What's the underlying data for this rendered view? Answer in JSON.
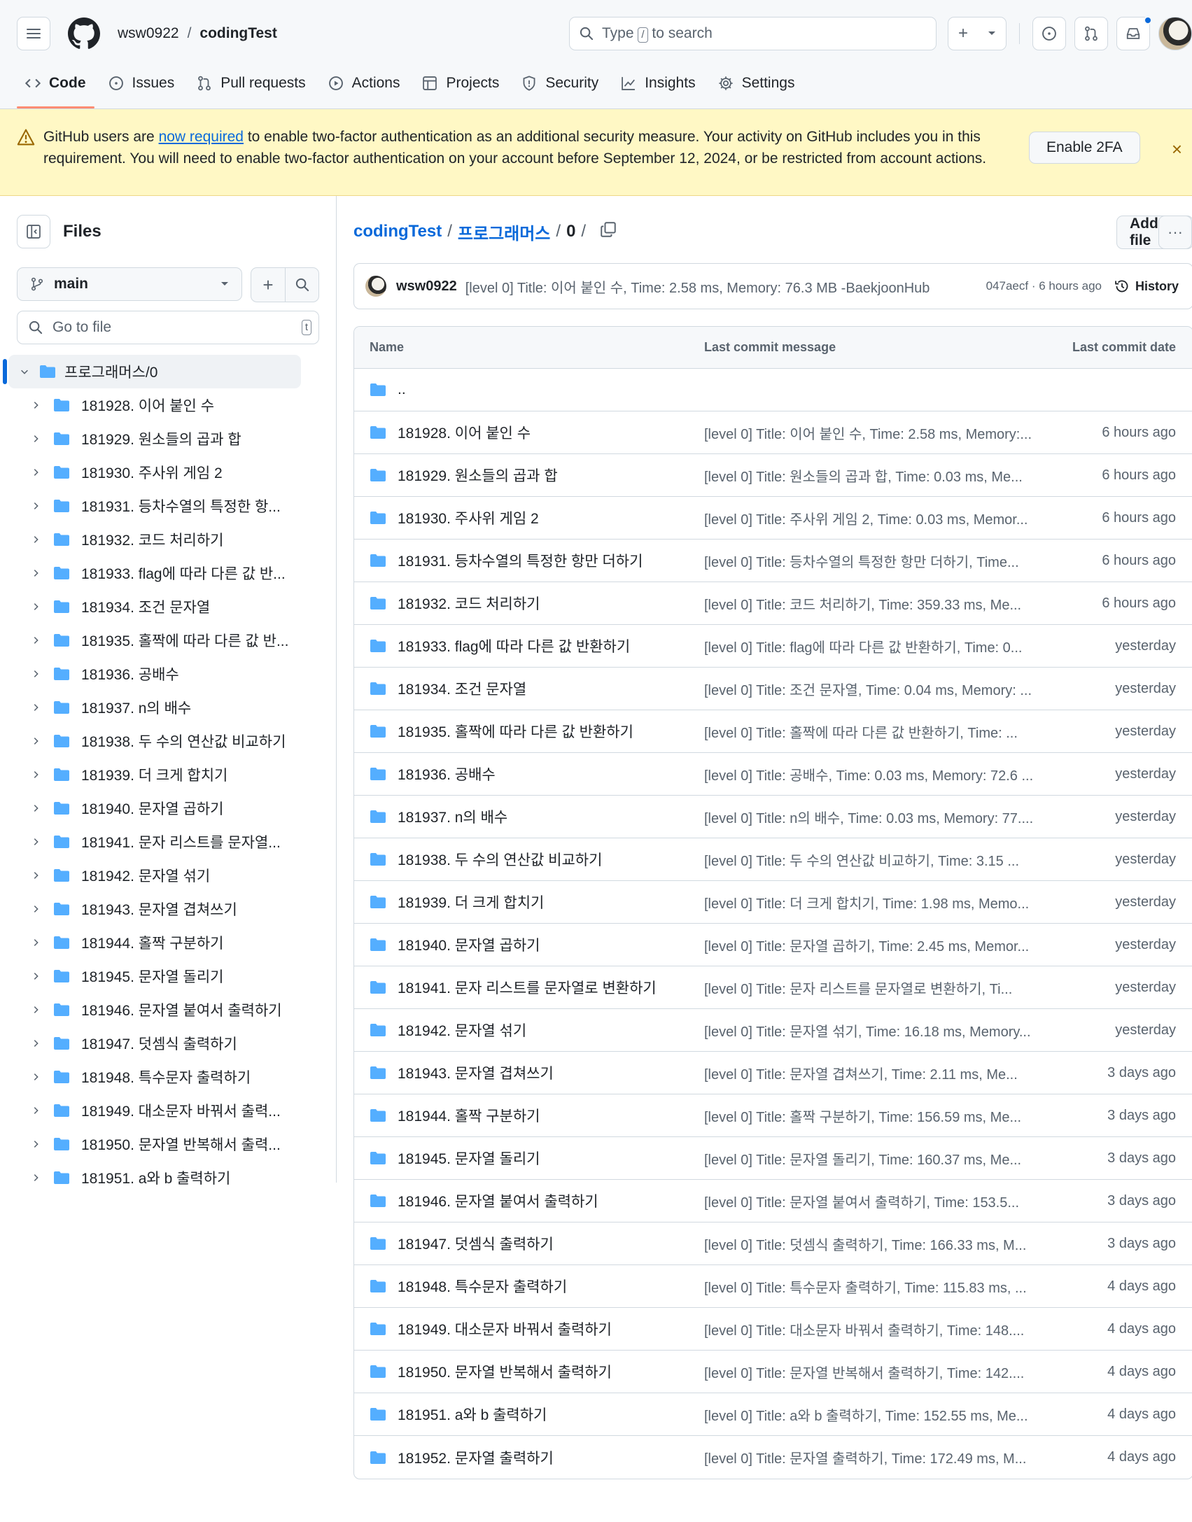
{
  "header": {
    "owner": "wsw0922",
    "separator": "/",
    "repo": "codingTest",
    "search_prefix": "Type",
    "search_key": "/",
    "search_suffix": "to search"
  },
  "nav": [
    {
      "label": "Code",
      "icon": "code-icon"
    },
    {
      "label": "Issues",
      "icon": "issue-opened-icon"
    },
    {
      "label": "Pull requests",
      "icon": "git-pull-request-icon"
    },
    {
      "label": "Actions",
      "icon": "play-icon"
    },
    {
      "label": "Projects",
      "icon": "table-icon"
    },
    {
      "label": "Security",
      "icon": "shield-icon"
    },
    {
      "label": "Insights",
      "icon": "graph-icon"
    },
    {
      "label": "Settings",
      "icon": "gear-icon"
    }
  ],
  "banner": {
    "text_before": "GitHub users are ",
    "link": "now required",
    "text_after": " to enable two-factor authentication as an additional security measure. Your activity on GitHub includes you in this requirement. You will need to enable two-factor authentication on your account before September 12, 2024, or be restricted from account actions.",
    "button": "Enable 2FA",
    "close": "×"
  },
  "sidebar": {
    "title": "Files",
    "branch": "main",
    "goto_placeholder": "Go to file",
    "goto_key": "t",
    "root": "프로그래머스/0",
    "items": [
      "181928. 이어 붙인 수",
      "181929. 원소들의 곱과 합",
      "181930. 주사위 게임 2",
      "181931. 등차수열의 특정한 항...",
      "181932. 코드 처리하기",
      "181933. flag에 따라 다른 값 반...",
      "181934. 조건 문자열",
      "181935. 홀짝에 따라 다른 값 반...",
      "181936. 공배수",
      "181937. n의 배수",
      "181938. 두 수의 연산값 비교하기",
      "181939. 더 크게 합치기",
      "181940. 문자열 곱하기",
      "181941. 문자 리스트를 문자열...",
      "181942. 문자열 섞기",
      "181943. 문자열 겹쳐쓰기",
      "181944. 홀짝 구분하기",
      "181945. 문자열 돌리기",
      "181946. 문자열 붙여서 출력하기",
      "181947. 덧셈식 출력하기",
      "181948. 특수문자 출력하기",
      "181949. 대소문자 바꿔서 출력...",
      "181950. 문자열 반복해서 출력...",
      "181951. a와 b 출력하기"
    ]
  },
  "breadcrumb": {
    "repo": "codingTest",
    "sep1": "/",
    "folder": "프로그래머스",
    "sep2": "/",
    "current": "0",
    "sep3": "/"
  },
  "actions": {
    "add_file": "Add file",
    "more": "···"
  },
  "latest_commit": {
    "author": "wsw0922",
    "message": "[level 0] Title: 이어 붙인 수, Time: 2.58 ms, Memory: 76.3 MB -BaekjoonHub",
    "meta": "047aecf · 6 hours ago",
    "history": "History"
  },
  "table": {
    "headers": {
      "name": "Name",
      "message": "Last commit message",
      "date": "Last commit date"
    },
    "parent": "..",
    "rows": [
      {
        "name": "181928. 이어 붙인 수",
        "message": "[level 0] Title: 이어 붙인 수, Time: 2.58 ms, Memory:...",
        "date": "6 hours ago"
      },
      {
        "name": "181929. 원소들의 곱과 합",
        "message": "[level 0] Title: 원소들의 곱과 합, Time: 0.03 ms, Me...",
        "date": "6 hours ago"
      },
      {
        "name": "181930. 주사위 게임 2",
        "message": "[level 0] Title: 주사위 게임 2, Time: 0.03 ms, Memor...",
        "date": "6 hours ago"
      },
      {
        "name": "181931. 등차수열의 특정한 항만 더하기",
        "message": "[level 0] Title: 등차수열의 특정한 항만 더하기, Time...",
        "date": "6 hours ago"
      },
      {
        "name": "181932. 코드 처리하기",
        "message": "[level 0] Title: 코드 처리하기, Time: 359.33 ms, Me...",
        "date": "6 hours ago"
      },
      {
        "name": "181933. flag에 따라 다른 값 반환하기",
        "message": "[level 0] Title: flag에 따라 다른 값 반환하기, Time: 0...",
        "date": "yesterday"
      },
      {
        "name": "181934. 조건 문자열",
        "message": "[level 0] Title: 조건 문자열, Time: 0.04 ms, Memory: ...",
        "date": "yesterday"
      },
      {
        "name": "181935. 홀짝에 따라 다른 값 반환하기",
        "message": "[level 0] Title: 홀짝에 따라 다른 값 반환하기, Time: ...",
        "date": "yesterday"
      },
      {
        "name": "181936. 공배수",
        "message": "[level 0] Title: 공배수, Time: 0.03 ms, Memory: 72.6 ...",
        "date": "yesterday"
      },
      {
        "name": "181937. n의 배수",
        "message": "[level 0] Title: n의 배수, Time: 0.03 ms, Memory: 77....",
        "date": "yesterday"
      },
      {
        "name": "181938. 두 수의 연산값 비교하기",
        "message": "[level 0] Title: 두 수의 연산값 비교하기, Time: 3.15 ...",
        "date": "yesterday"
      },
      {
        "name": "181939. 더 크게 합치기",
        "message": "[level 0] Title: 더 크게 합치기, Time: 1.98 ms, Memo...",
        "date": "yesterday"
      },
      {
        "name": "181940. 문자열 곱하기",
        "message": "[level 0] Title: 문자열 곱하기, Time: 2.45 ms, Memor...",
        "date": "yesterday"
      },
      {
        "name": "181941. 문자 리스트를 문자열로 변환하기",
        "message": "[level 0] Title: 문자 리스트를 문자열로 변환하기, Ti...",
        "date": "yesterday"
      },
      {
        "name": "181942. 문자열 섞기",
        "message": "[level 0] Title: 문자열 섞기, Time: 16.18 ms, Memory...",
        "date": "yesterday"
      },
      {
        "name": "181943. 문자열 겹쳐쓰기",
        "message": "[level 0] Title: 문자열 겹쳐쓰기, Time: 2.11 ms, Me...",
        "date": "3 days ago"
      },
      {
        "name": "181944. 홀짝 구분하기",
        "message": "[level 0] Title: 홀짝 구분하기, Time: 156.59 ms, Me...",
        "date": "3 days ago"
      },
      {
        "name": "181945. 문자열 돌리기",
        "message": "[level 0] Title: 문자열 돌리기, Time: 160.37 ms, Me...",
        "date": "3 days ago"
      },
      {
        "name": "181946. 문자열 붙여서 출력하기",
        "message": "[level 0] Title: 문자열 붙여서 출력하기, Time: 153.5...",
        "date": "3 days ago"
      },
      {
        "name": "181947. 덧셈식 출력하기",
        "message": "[level 0] Title: 덧셈식 출력하기, Time: 166.33 ms, M...",
        "date": "3 days ago"
      },
      {
        "name": "181948. 특수문자 출력하기",
        "message": "[level 0] Title: 특수문자 출력하기, Time: 115.83 ms, ...",
        "date": "4 days ago"
      },
      {
        "name": "181949. 대소문자 바꿔서 출력하기",
        "message": "[level 0] Title: 대소문자 바꿔서 출력하기, Time: 148....",
        "date": "4 days ago"
      },
      {
        "name": "181950. 문자열 반복해서 출력하기",
        "message": "[level 0] Title: 문자열 반복해서 출력하기, Time: 142....",
        "date": "4 days ago"
      },
      {
        "name": "181951. a와 b 출력하기",
        "message": "[level 0] Title: a와 b 출력하기, Time: 152.55 ms, Me...",
        "date": "4 days ago"
      },
      {
        "name": "181952. 문자열 출력하기",
        "message": "[level 0] Title: 문자열 출력하기, Time: 172.49 ms, M...",
        "date": "4 days ago"
      }
    ]
  },
  "colors": {
    "accent": "#0969da",
    "folder": "#54aeff",
    "nav_underline": "#fd8c73",
    "banner_bg": "#fff8c5"
  }
}
